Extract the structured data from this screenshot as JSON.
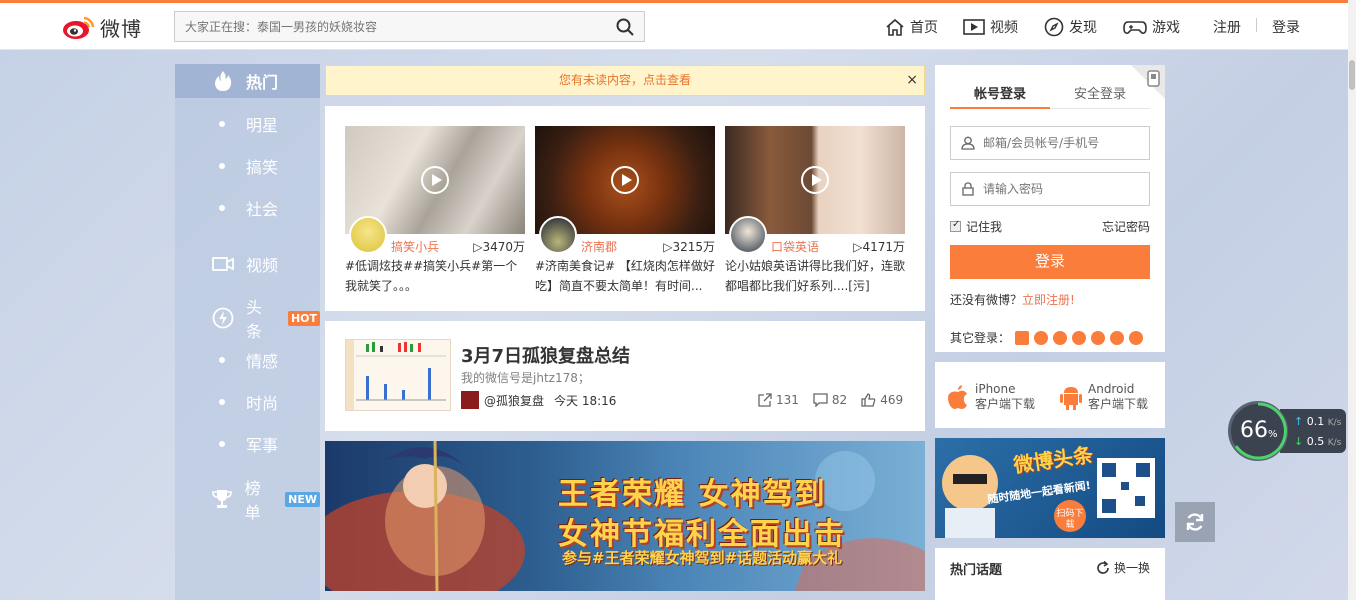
{
  "header": {
    "logo_text": "微博",
    "search_placeholder": "大家正在搜：泰国一男孩的妖娆妆容",
    "nav": [
      {
        "label": "首页",
        "icon": "home-icon"
      },
      {
        "label": "视频",
        "icon": "video-icon"
      },
      {
        "label": "发现",
        "icon": "compass-icon"
      },
      {
        "label": "游戏",
        "icon": "gamepad-icon"
      }
    ],
    "register": "注册",
    "login": "登录"
  },
  "sidebar": {
    "items": [
      {
        "label": "热门",
        "icon": "fire-icon"
      },
      {
        "label": "明星"
      },
      {
        "label": "搞笑"
      },
      {
        "label": "社会"
      },
      {
        "label": "视频",
        "icon": "camera-icon"
      },
      {
        "label": "头条",
        "icon": "lightning-icon",
        "badge": "HOT"
      },
      {
        "label": "情感"
      },
      {
        "label": "时尚"
      },
      {
        "label": "军事"
      },
      {
        "label": "榜单",
        "icon": "trophy-icon",
        "badge": "NEW"
      }
    ]
  },
  "notice": {
    "text": "您有未读内容，点击查看",
    "close": "×"
  },
  "videos": [
    {
      "user": "搞笑小兵",
      "count": "▷3470万",
      "desc": "#低调炫技##搞笑小兵#第一个我就笑了。。。 http://t.cn/RqRYv..."
    },
    {
      "user": "济南郡",
      "count": "▷3215万",
      "desc": "#济南美食记# 【红烧肉怎样做好吃】简直不要太简单！有时间..."
    },
    {
      "user": "口袋英语",
      "count": "▷4171万",
      "desc": "论小姑娘英语讲得比我们好，连歌都唱都比我们好系列....[污] http:/..."
    }
  ],
  "article": {
    "title": "3月7日孤狼复盘总结",
    "subtitle": "我的微信号是jhtz178；",
    "user": "@孤狼复盘",
    "time": "今天 18:16",
    "shares": "131",
    "comments": "82",
    "likes": "469"
  },
  "banner": {
    "line1": "王者荣耀 女神驾到",
    "line2": "女神节福利全面出击",
    "line3": "参与#王者荣耀女神驾到#话题活动赢大礼"
  },
  "login": {
    "tab_account": "帐号登录",
    "tab_secure": "安全登录",
    "user_placeholder": "邮箱/会员帐号/手机号",
    "pass_placeholder": "请输入密码",
    "remember": "记住我",
    "forgot": "忘记密码",
    "submit": "登录",
    "no_account": "还没有微博？",
    "register_link": "立即注册!",
    "other_login": "其它登录："
  },
  "apps": {
    "iphone": "iPhone",
    "iphone_sub": "客户端下载",
    "android": "Android",
    "android_sub": "客户端下载"
  },
  "ad": {
    "title": "微博头条",
    "slogan": "随时随地一起看新闻!",
    "scan": "扫码下载"
  },
  "hot_topics": {
    "title": "热门话题",
    "refresh": "换一换"
  },
  "speed_widget": {
    "percent": "66",
    "unit": "%",
    "up": "0.1",
    "down": "0.5",
    "rate_unit": "K/s"
  },
  "colors": {
    "accent": "#fa7d3c",
    "link": "#eb7350"
  }
}
